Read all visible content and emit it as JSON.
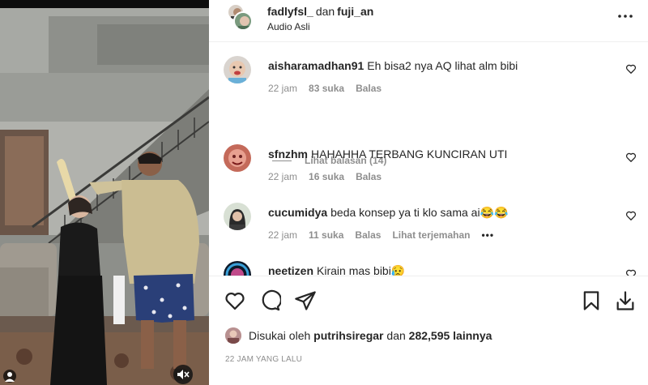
{
  "post": {
    "author1": "fadlyfsl_",
    "connector": "dan",
    "author2": "fuji_an",
    "audio": "Audio Asli"
  },
  "comments": [
    {
      "user": "aisharamadhan91",
      "text": "Eh bisa2 nya AQ lihat alm bibi",
      "time": "22 jam",
      "likes": "83 suka",
      "reply": "Balas"
    },
    {
      "user": "sfnzhm",
      "text": "HAHAHHA TERBANG KUNCIRAN UTI",
      "time": "22 jam",
      "likes": "16 suka",
      "reply": "Balas"
    },
    {
      "user": "cucumidya",
      "text": "beda konsep ya ti klo sama ai😂😂",
      "time": "22 jam",
      "likes": "11 suka",
      "reply": "Balas",
      "translate": "Lihat terjemahan"
    },
    {
      "user": "neetizen",
      "text": "Kirain mas bibi😥"
    }
  ],
  "view_replies": "Lihat balasan (14)",
  "liked_by": {
    "prefix": "Disukai oleh",
    "user": "putrihsiregar",
    "connector": "dan",
    "others": "282,595 lainnya"
  },
  "posted_ago": "22 JAM YANG LALU",
  "icons": {
    "like": "heart-icon",
    "comment": "comment-icon",
    "share": "send-icon",
    "save": "bookmark-icon",
    "download": "download-icon",
    "more": "more-options-icon",
    "mute": "mute-icon",
    "tag": "user-tag-icon"
  }
}
